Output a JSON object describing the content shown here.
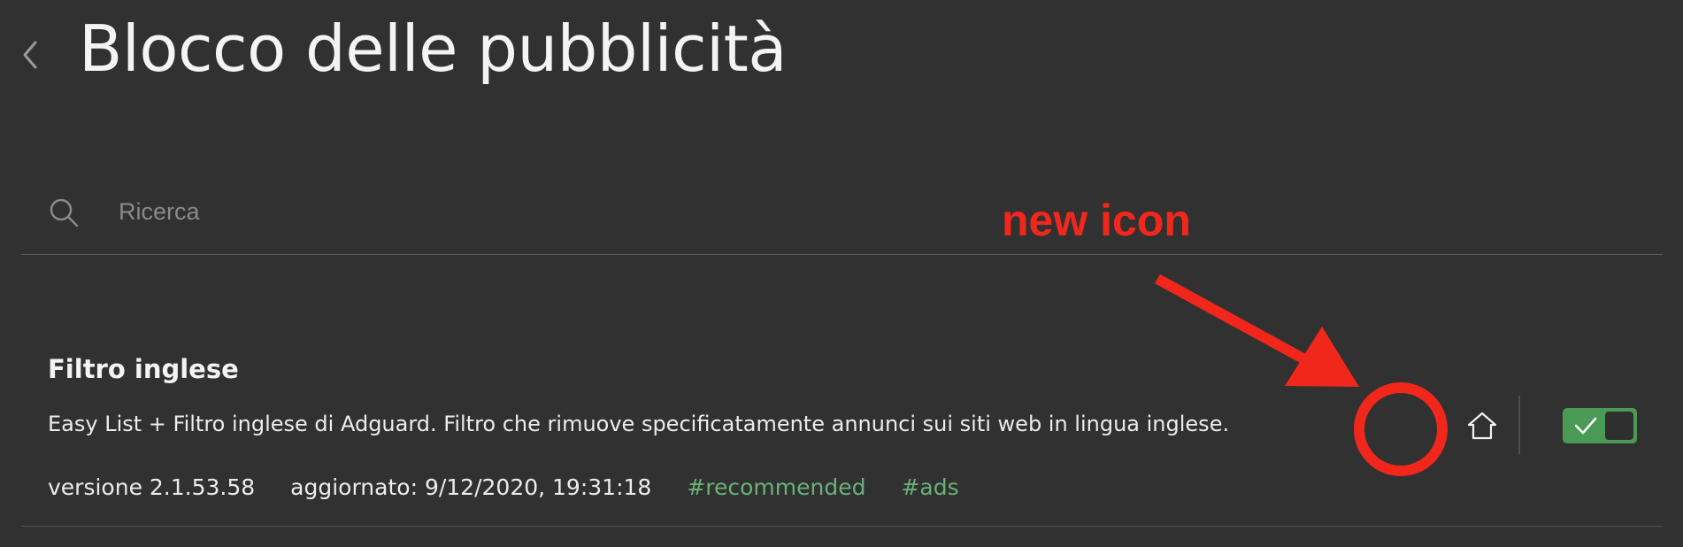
{
  "header": {
    "title": "Blocco delle pubblicità"
  },
  "search": {
    "placeholder": "Ricerca",
    "value": ""
  },
  "annotation": {
    "label": "new icon",
    "color": "#f2271c"
  },
  "filter": {
    "name": "Filtro inglese",
    "description": "Easy List + Filtro inglese di Adguard. Filtro che rimuove specificatamente annunci sui siti web in lingua inglese.",
    "version": "versione 2.1.53.58",
    "updated": "aggiornato: 9/12/2020, 19:31:18",
    "tags": [
      "#recommended",
      "#ads"
    ],
    "enabled": true
  },
  "colors": {
    "background": "#313131",
    "tag": "#67b279",
    "toggle_on": "#4a9a56"
  },
  "icons": {
    "back": "chevron-left-icon",
    "search": "search-icon",
    "home": "home-icon",
    "check": "check-icon"
  }
}
